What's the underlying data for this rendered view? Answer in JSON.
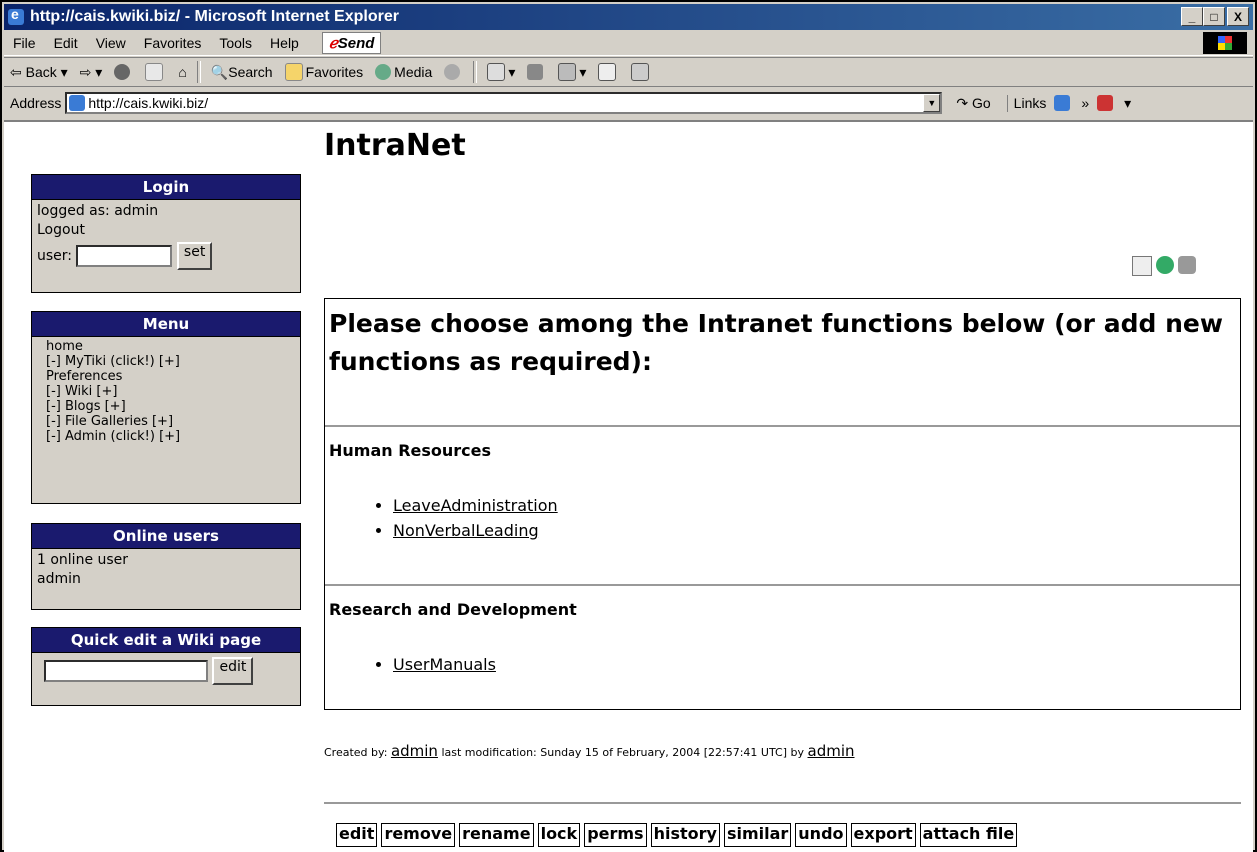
{
  "window": {
    "title": "http://cais.kwiki.biz/ - Microsoft Internet Explorer",
    "minimize": "_",
    "maximize": "□",
    "close": "X"
  },
  "menubar": {
    "items": [
      "File",
      "Edit",
      "View",
      "Favorites",
      "Tools",
      "Help"
    ],
    "send_label": "Send"
  },
  "toolbar": {
    "back": "Back",
    "search": "Search",
    "favorites": "Favorites",
    "media": "Media"
  },
  "address": {
    "label": "Address",
    "url": "http://cais.kwiki.biz/",
    "go": "Go",
    "links": "Links"
  },
  "login": {
    "header": "Login",
    "logged_as": "logged as: admin",
    "logout": "Logout",
    "user_label": "user:",
    "set_button": "set"
  },
  "menu": {
    "header": "Menu",
    "items": [
      "home",
      "[-] MyTiki (click!) [+]",
      "Preferences",
      "[-] Wiki [+]",
      "[-] Blogs [+]",
      "[-] File Galleries [+]",
      "[-] Admin (click!) [+]"
    ]
  },
  "online": {
    "header": "Online users",
    "count": "1 online user",
    "user": "admin"
  },
  "quickedit": {
    "header": "Quick edit a Wiki page",
    "button": "edit"
  },
  "page": {
    "title": "IntraNet",
    "heading": "Please choose among the Intranet functions below (or add new functions as required):",
    "sections": [
      {
        "title": "Human Resources",
        "links": [
          "LeaveAdministration",
          "NonVerbalLeading"
        ]
      },
      {
        "title": "Research and Development",
        "links": [
          "UserManuals"
        ]
      }
    ],
    "footer": {
      "created_by": "Created by:",
      "author": "admin",
      "last_mod": "last modification: Sunday 15 of February, 2004 [22:57:41 UTC] by",
      "modifier": "admin"
    },
    "actions": [
      "edit",
      "remove",
      "rename",
      "lock",
      "perms",
      "history",
      "similar",
      "undo",
      "export",
      "attach file"
    ]
  }
}
